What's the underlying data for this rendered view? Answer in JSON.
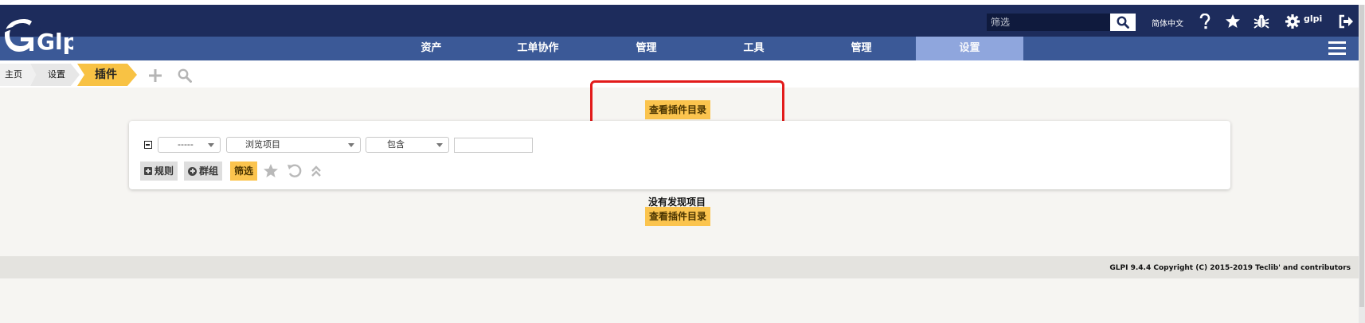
{
  "header": {
    "logo_text": "Glpi",
    "search_placeholder": "筛选",
    "language": "简体中文",
    "user": "glpi"
  },
  "nav": {
    "items": [
      {
        "label": "资产"
      },
      {
        "label": "工单协作"
      },
      {
        "label": "管理"
      },
      {
        "label": "工具"
      },
      {
        "label": "管理"
      },
      {
        "label": "设置"
      }
    ],
    "active_index": 5
  },
  "breadcrumb": {
    "home": "主页",
    "settings": "设置",
    "plugins": "插件"
  },
  "catalog_button_top": "查看插件目录",
  "search_panel": {
    "field_select": "-----",
    "item_select": "浏览项目",
    "operator_select": "包含",
    "value_input": "",
    "rule_button": "规则",
    "group_button": "群组",
    "filter_button": "筛选"
  },
  "results": {
    "no_items": "没有发现项目",
    "catalog_button": "查看插件目录"
  },
  "footer": {
    "copyright": "GLPI 9.4.4 Copyright (C) 2015-2019 Teclib' and contributors"
  },
  "colors": {
    "header_bg": "#1d2c5c",
    "nav_bg": "#3b5997",
    "nav_active": "#8fa6dd",
    "accent_yellow": "#fbc44e",
    "annotation_red": "#e21b1b"
  }
}
